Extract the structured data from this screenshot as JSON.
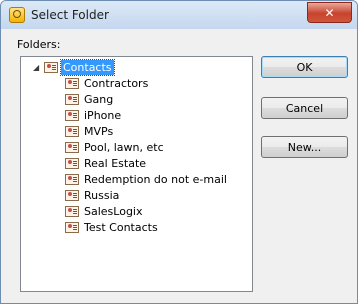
{
  "window": {
    "title": "Select Folder",
    "close_glyph": "✕"
  },
  "tree": {
    "label": "Folders:",
    "expander_glyph": "◢",
    "root": {
      "label": "Contacts",
      "icon": "contact-folder-icon",
      "selected": true
    },
    "children": [
      {
        "label": "Contractors",
        "icon": "contact-folder-icon"
      },
      {
        "label": "Gang",
        "icon": "contact-folder-icon"
      },
      {
        "label": "iPhone",
        "icon": "contact-folder-icon"
      },
      {
        "label": "MVPs",
        "icon": "contact-folder-icon"
      },
      {
        "label": "Pool, lawn, etc",
        "icon": "contact-folder-icon"
      },
      {
        "label": "Real Estate",
        "icon": "contact-folder-icon"
      },
      {
        "label": "Redemption do not e-mail",
        "icon": "contact-folder-icon"
      },
      {
        "label": "Russia",
        "icon": "contact-folder-icon"
      },
      {
        "label": "SalesLogix",
        "icon": "contact-folder-icon"
      },
      {
        "label": "Test Contacts",
        "icon": "contact-folder-icon"
      }
    ]
  },
  "buttons": {
    "ok": "OK",
    "cancel": "Cancel",
    "new": "New..."
  },
  "colors": {
    "selection": "#3399ff",
    "title_bar": "#dce9f7",
    "close": "#c7432d"
  }
}
